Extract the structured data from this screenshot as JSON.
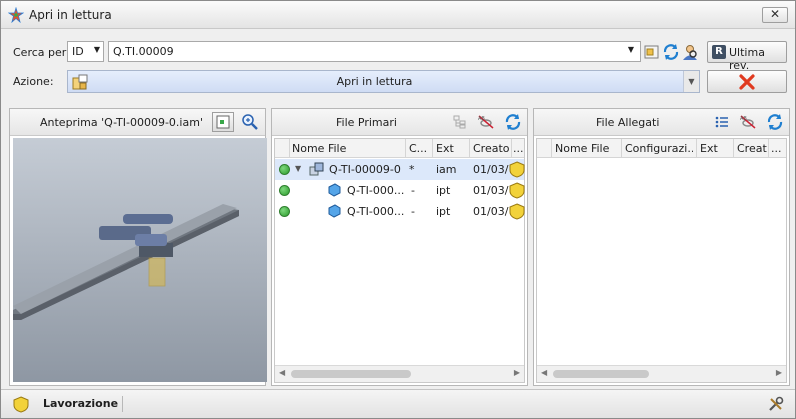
{
  "window": {
    "title": "Apri in lettura",
    "close_glyph": "✕"
  },
  "search": {
    "label": "Cerca per",
    "field_value": "ID",
    "query": "Q.TI.00009",
    "latest_rev_label": "Ultima rev."
  },
  "action": {
    "label": "Azione:",
    "value": "Apri in lettura"
  },
  "preview": {
    "title": "Anteprima 'Q-TI-00009-0.iam'"
  },
  "primary": {
    "title": "File Primari",
    "columns": [
      "Nome File",
      "C...",
      "Ext",
      "Creato",
      "..."
    ],
    "rows": [
      {
        "name": "Q-TI-00009-0",
        "c": "*",
        "ext": "iam",
        "created": "01/03/"
      },
      {
        "name": "Q-TI-000...",
        "c": "-",
        "ext": "ipt",
        "created": "01/03/"
      },
      {
        "name": "Q-TI-000...",
        "c": "-",
        "ext": "ipt",
        "created": "01/03/"
      }
    ]
  },
  "attached": {
    "title": "File Allegati",
    "columns": [
      "Nome File",
      "Configurazi...",
      "Ext",
      "Creato",
      "..."
    ]
  },
  "status": {
    "label": "Lavorazione"
  },
  "colors": {
    "accent": "#cfdcf4",
    "status_ok": "#2b9b2b",
    "cancel": "#e03a1f"
  }
}
